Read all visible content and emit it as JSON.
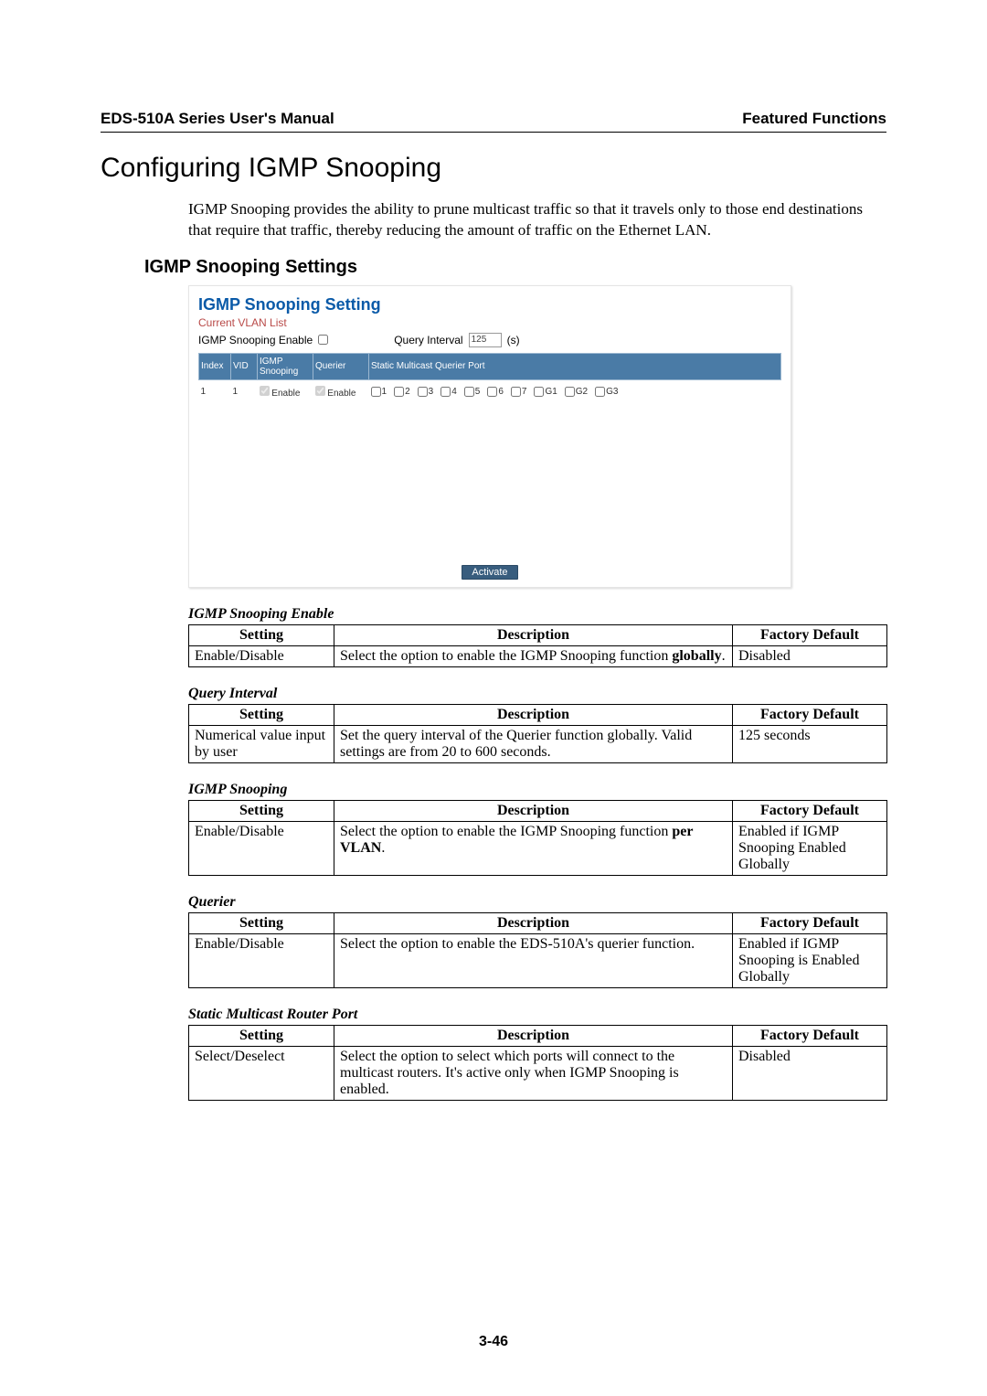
{
  "header": {
    "left": "EDS-510A Series User's Manual",
    "right": "Featured Functions"
  },
  "title": "Configuring IGMP Snooping",
  "intro": "IGMP Snooping provides the ability to prune multicast traffic so that it travels only to those end destinations that require that traffic, thereby reducing the amount of traffic on the Ethernet LAN.",
  "section_heading": "IGMP Snooping Settings",
  "screenshot": {
    "title": "IGMP Snooping Setting",
    "subtitle": "Current VLAN List",
    "enable_label": "IGMP Snooping Enable",
    "query_label": "Query Interval",
    "query_value": "125",
    "query_unit": "(s)",
    "columns": {
      "index": "Index",
      "vid": "VID",
      "igmp": "IGMP Snooping",
      "querier": "Querier",
      "static": "Static Multicast Querier Port"
    },
    "row1": {
      "index": "1",
      "vid": "1",
      "igmp": "Enable",
      "querier": "Enable"
    },
    "ports": [
      "1",
      "2",
      "3",
      "4",
      "5",
      "6",
      "7",
      "G1",
      "G2",
      "G3"
    ],
    "activate": "Activate"
  },
  "tables": {
    "enable": {
      "title": "IGMP Snooping Enable",
      "setting": "Enable/Disable",
      "desc_a": "Select the option to enable the IGMP Snooping function ",
      "desc_b": "globally",
      "desc_c": ".",
      "default": "Disabled"
    },
    "query": {
      "title": "Query Interval",
      "setting": "Numerical value input by user",
      "desc": "Set the query interval of the Querier function globally. Valid settings are from 20 to 600 seconds.",
      "default": "125 seconds"
    },
    "snoop": {
      "title": "IGMP Snooping",
      "setting": "Enable/Disable",
      "desc_a": "Select the option to enable the IGMP Snooping function ",
      "desc_b": "per VLAN",
      "desc_c": ".",
      "default": "Enabled if IGMP Snooping Enabled Globally"
    },
    "querier": {
      "title": "Querier",
      "setting": "Enable/Disable",
      "desc": "Select the option to enable the EDS-510A's querier function.",
      "default": "Enabled if IGMP Snooping is Enabled Globally"
    },
    "static": {
      "title": "Static Multicast Router Port",
      "setting": "Select/Deselect",
      "desc": "Select the option to select which ports will connect to the multicast routers. It's active only when IGMP Snooping is enabled.",
      "default": "Disabled"
    },
    "headers": {
      "setting": "Setting",
      "description": "Description",
      "default": "Factory Default"
    }
  },
  "page_number": "3-46"
}
